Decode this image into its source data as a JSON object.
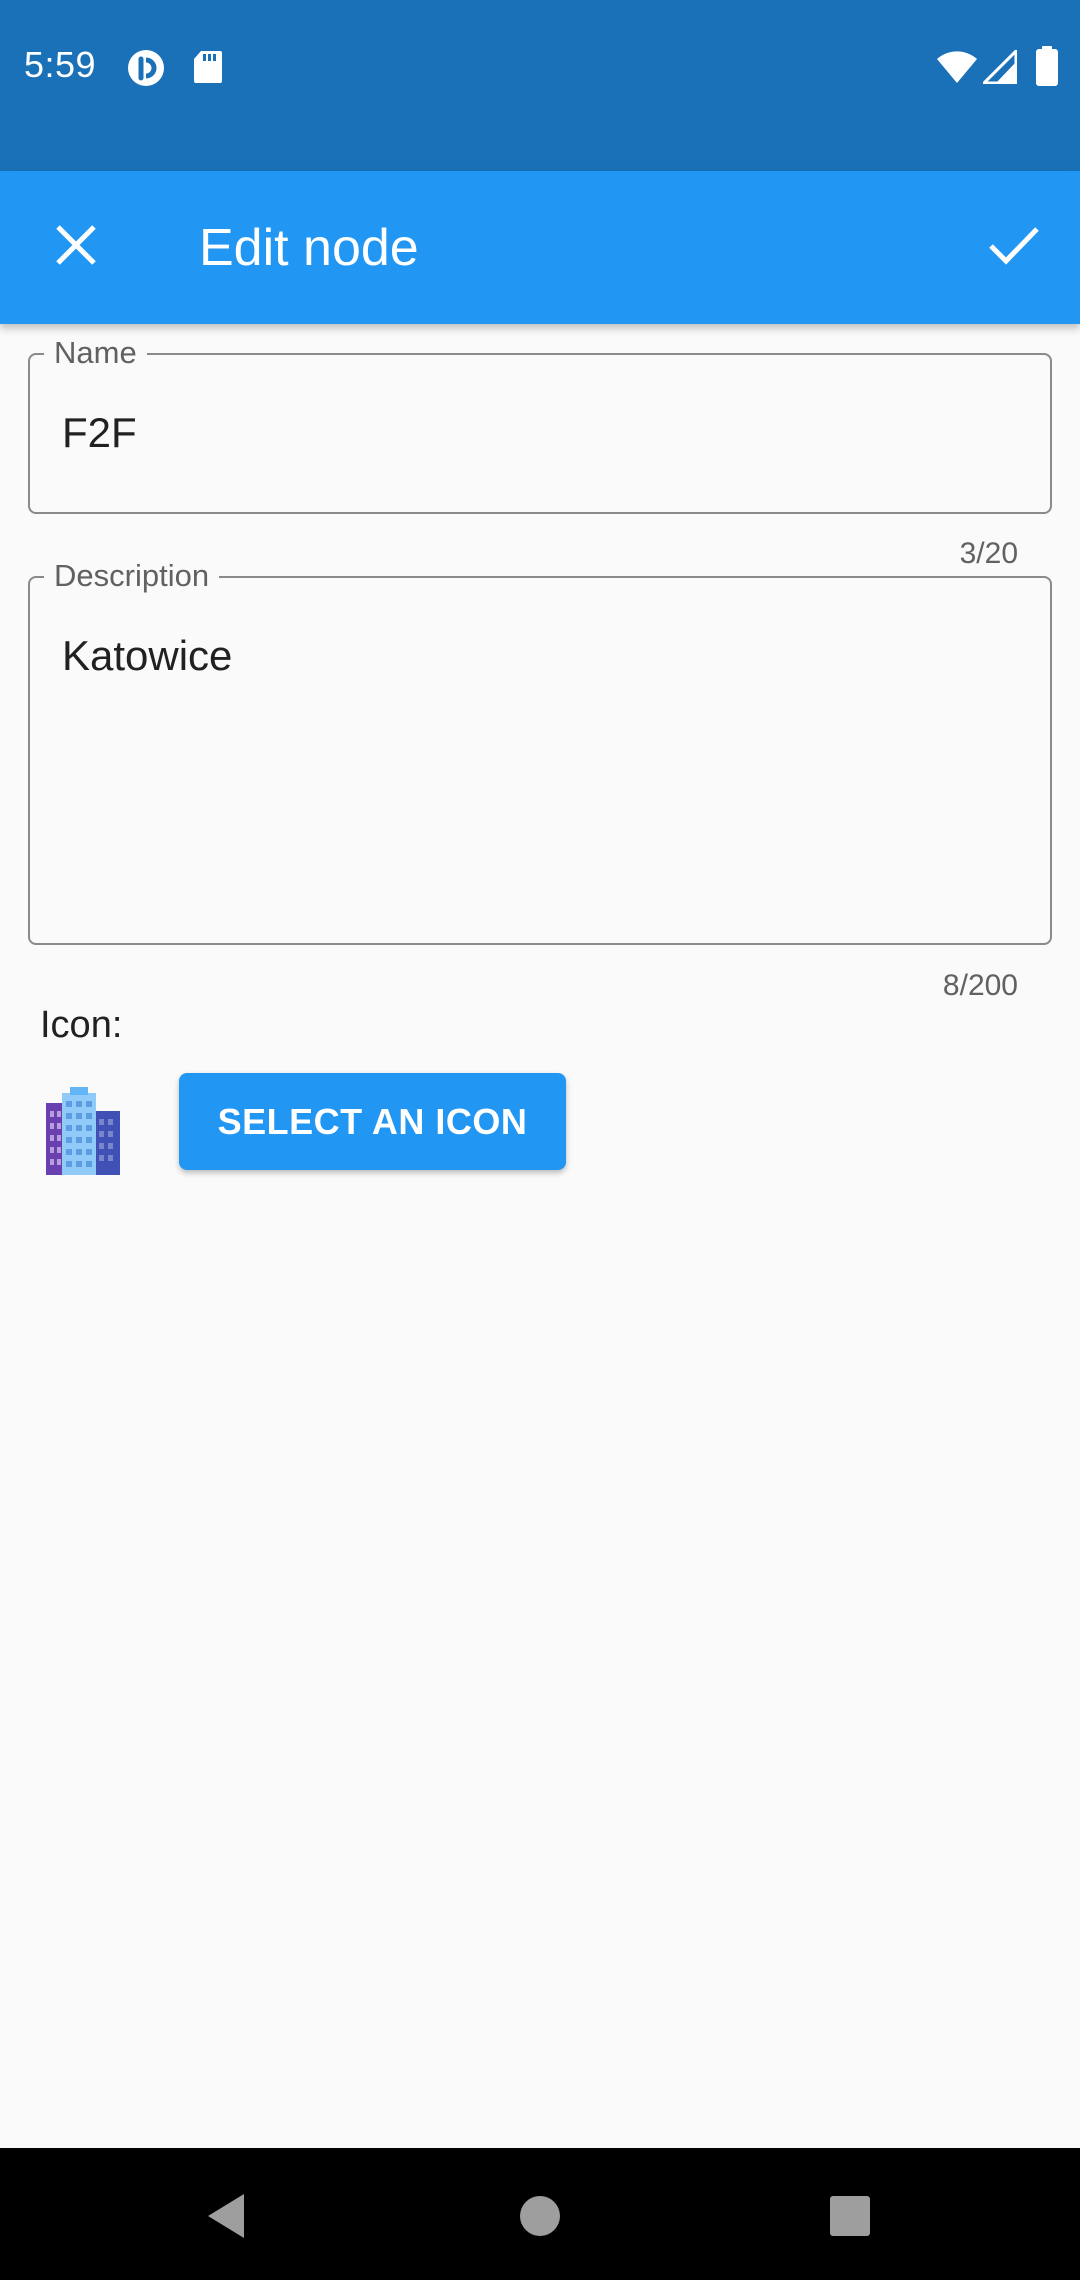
{
  "status_bar": {
    "time": "5:59",
    "icons_left": [
      "pocket-casts-icon",
      "sd-card-icon"
    ],
    "icons_right": [
      "wifi-icon",
      "cellular-signal-icon",
      "battery-icon"
    ]
  },
  "app_bar": {
    "title": "Edit node",
    "close_icon": "close-icon",
    "confirm_icon": "check-icon",
    "background": "#2196f3"
  },
  "form": {
    "name": {
      "label": "Name",
      "value": "F2F",
      "counter": "3/20"
    },
    "description": {
      "label": "Description",
      "value": "Katowice",
      "counter": "8/200"
    },
    "icon": {
      "label": "Icon:",
      "selected_icon": "office-building-icon",
      "button_label": "SELECT AN ICON"
    }
  },
  "nav_bar": {
    "buttons": [
      "back-icon",
      "home-icon",
      "recents-icon"
    ]
  }
}
